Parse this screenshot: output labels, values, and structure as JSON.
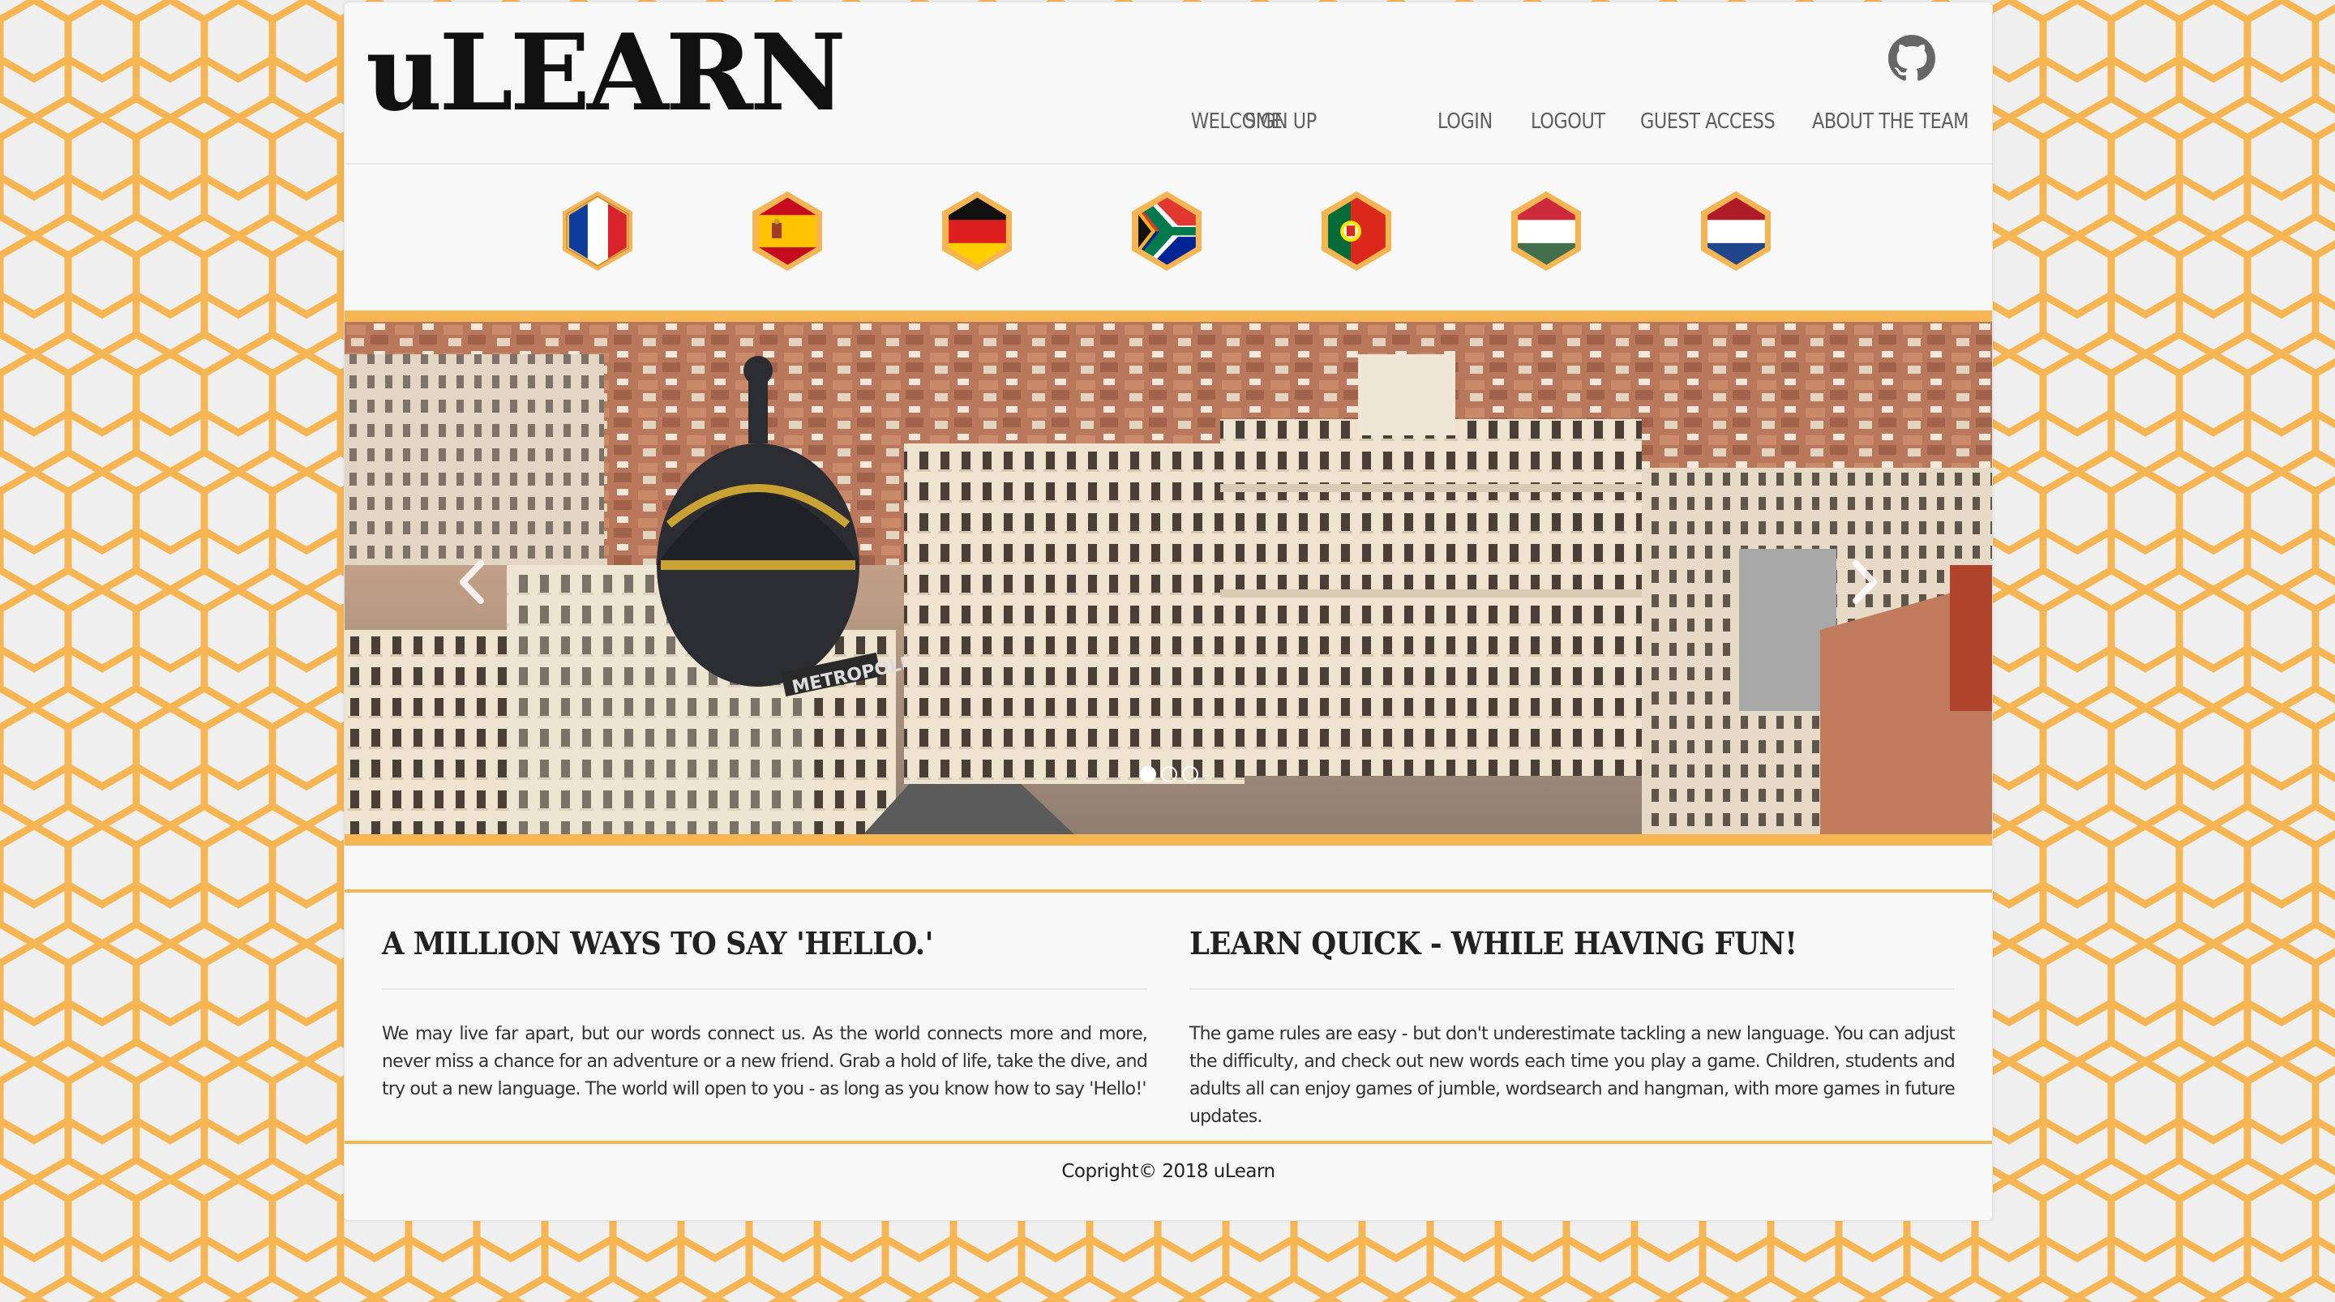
{
  "site": {
    "logo": "uLEARN",
    "github_icon": "github-icon"
  },
  "nav": {
    "items": [
      {
        "label": "WELCOME"
      },
      {
        "label": "SIGN UP"
      },
      {
        "label": "LOGIN"
      },
      {
        "label": "LOGOUT"
      },
      {
        "label": "GUEST ACCESS"
      },
      {
        "label": "ABOUT THE TEAM"
      }
    ]
  },
  "languages": [
    {
      "name": "french-flag-icon"
    },
    {
      "name": "spanish-flag-icon"
    },
    {
      "name": "german-flag-icon"
    },
    {
      "name": "south-african-flag-icon"
    },
    {
      "name": "portuguese-flag-icon"
    },
    {
      "name": "hungarian-flag-icon"
    },
    {
      "name": "dutch-flag-icon"
    }
  ],
  "carousel": {
    "slide_count": 3,
    "active_slide": 1,
    "image_sign": "METROPOLIS"
  },
  "features": [
    {
      "title": "A MILLION WAYS TO SAY 'HELLO.'",
      "body": "We may live far apart, but our words connect us. As the world connects more and more, never miss a chance for an adventure or a new friend. Grab a hold of life, take the dive, and try out a new language. The world will open to you - as long as you know how to say 'Hello!'"
    },
    {
      "title": "LEARN QUICK - WHILE HAVING FUN!",
      "body": "The game rules are easy - but don't underestimate tackling a new language. You can adjust the difficulty, and check out new words each time you play a game. Children, students and adults all can enjoy games of jumble, wordsearch and hangman, with more games in future updates."
    }
  ],
  "footer": {
    "copyright": "Copright© 2018 uLearn"
  },
  "colors": {
    "accent": "#f5b552",
    "honeycomb": "#f5b552",
    "background": "#efefef",
    "panel": "#f8f8f8",
    "nav_text": "#5e5e5e"
  }
}
